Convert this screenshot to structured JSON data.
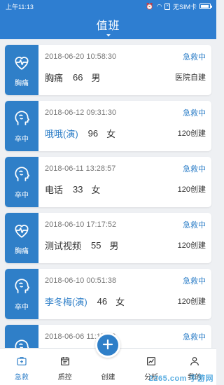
{
  "status_bar": {
    "time": "上午11:13",
    "sim": "无SIM卡",
    "alarm_icon": "alarm-icon",
    "wifi_icon": "wifi-icon",
    "battery_icon": "battery-icon"
  },
  "header": {
    "title": "值班"
  },
  "records": [
    {
      "badge_icon": "heart-pulse-icon",
      "badge_label": "胸痛",
      "time": "2018-06-20 10:58:30",
      "status": "急救中",
      "name": "胸痛",
      "name_link": false,
      "age": "66",
      "gender": "男",
      "origin": "医院自建"
    },
    {
      "badge_icon": "brain-head-icon",
      "badge_label": "卒中",
      "time": "2018-06-12 09:31:30",
      "status": "急救中",
      "name": "哦哦(演)",
      "name_link": true,
      "age": "96",
      "gender": "女",
      "origin": "120创建"
    },
    {
      "badge_icon": "brain-head-icon",
      "badge_label": "卒中",
      "time": "2018-06-11 13:28:57",
      "status": "急救中",
      "name": "电话",
      "name_link": false,
      "age": "33",
      "gender": "女",
      "origin": "120创建"
    },
    {
      "badge_icon": "heart-pulse-icon",
      "badge_label": "胸痛",
      "time": "2018-06-10 17:17:52",
      "status": "急救中",
      "name": "测试视频",
      "name_link": false,
      "age": "55",
      "gender": "男",
      "origin": "120创建"
    },
    {
      "badge_icon": "brain-head-icon",
      "badge_label": "卒中",
      "time": "2018-06-10 00:51:38",
      "status": "急救中",
      "name": "李冬梅(演)",
      "name_link": true,
      "age": "46",
      "gender": "女",
      "origin": "120创建"
    },
    {
      "badge_icon": "brain-head-icon",
      "badge_label": "",
      "time": "2018-06-06 11:15:03",
      "status": "急救中",
      "name": "",
      "name_link": false,
      "age": "",
      "gender": "",
      "origin": ""
    }
  ],
  "nav": {
    "items": [
      {
        "label": "急救",
        "icon": "first-aid-icon",
        "active": true
      },
      {
        "label": "质控",
        "icon": "calendar-icon",
        "active": false
      },
      {
        "label": "创建",
        "icon": "plus-icon",
        "active": false
      },
      {
        "label": "分析",
        "icon": "chart-icon",
        "active": false
      },
      {
        "label": "我的",
        "icon": "user-icon",
        "active": false
      }
    ]
  },
  "watermark": "2265.com 手游网",
  "colors": {
    "primary": "#2e7ed1",
    "accent": "#2f7fc8"
  }
}
